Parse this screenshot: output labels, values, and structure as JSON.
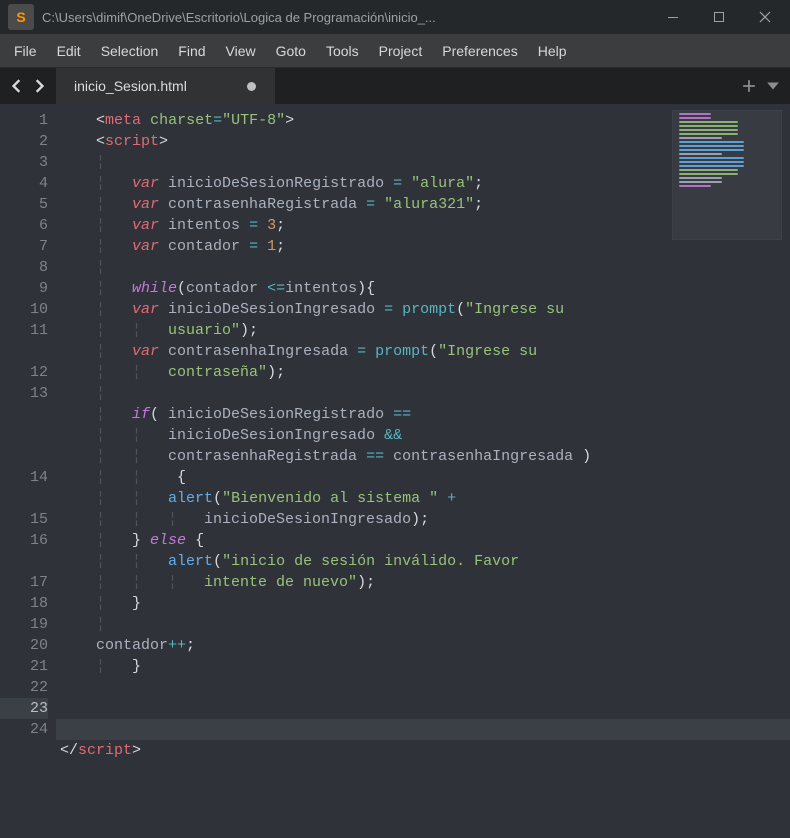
{
  "window": {
    "title": "C:\\Users\\dimif\\OneDrive\\Escritorio\\Logica de Programación\\inicio_...",
    "app_icon_glyph": "S"
  },
  "menu": {
    "items": [
      "File",
      "Edit",
      "Selection",
      "Find",
      "View",
      "Goto",
      "Tools",
      "Project",
      "Preferences",
      "Help"
    ]
  },
  "tab": {
    "label": "inicio_Sesion.html"
  },
  "gutter": {
    "lines": [
      "1",
      "2",
      "3",
      "4",
      "5",
      "6",
      "7",
      "8",
      "9",
      "10",
      "11",
      "12",
      "13",
      "14",
      "15",
      "16",
      "17",
      "18",
      "19",
      "20",
      "21",
      "22",
      "23",
      "24"
    ],
    "current_index": 22
  },
  "code": {
    "l1": {
      "tag": "meta",
      "attr": "charset",
      "eq": "=",
      "val": "\"UTF-8\""
    },
    "l2": {
      "tag": "script"
    },
    "l4": {
      "kw": "var",
      "id": "inicioDeSesionRegistrado",
      "op": "=",
      "val": "\"alura\""
    },
    "l5": {
      "kw": "var",
      "id": "contrasenhaRegistrada",
      "op": "=",
      "val": "\"alura321\""
    },
    "l6": {
      "kw": "var",
      "id": "intentos",
      "op": "=",
      "val": "3"
    },
    "l7": {
      "kw": "var",
      "id": "contador",
      "op": "=",
      "val": "1"
    },
    "l9": {
      "kw": "while",
      "expr_a": "contador",
      "op": "<=",
      "expr_b": "intentos"
    },
    "l10": {
      "kw": "var",
      "id": "inicioDeSesionIngresado",
      "op": "=",
      "fn": "prompt",
      "arg": "\"Ingrese su",
      "arg_wrap": "usuario\""
    },
    "l11": {
      "kw": "var",
      "id": "contrasenhaIngresada",
      "op": "=",
      "fn": "prompt",
      "arg": "\"Ingrese su",
      "arg_wrap": "contraseña\""
    },
    "l13": {
      "kw": "if",
      "a": "inicioDeSesionRegistrado",
      "op1": "==",
      "b": "inicioDeSesionIngresado",
      "and": "&&",
      "c": "contrasenhaRegistrada",
      "op2": "==",
      "d": "contrasenhaIngresada"
    },
    "l14": {
      "fn": "alert",
      "arg": "\"Bienvenido al sistema \"",
      "plus": "+",
      "wrap": "inicioDeSesionIngresado"
    },
    "l15": {
      "close": "}",
      "kw": "else",
      "open": "{"
    },
    "l16": {
      "fn": "alert",
      "arg": "\"inicio de sesión inválido. Favor",
      "wrap": "intente de nuevo\""
    },
    "l17": {
      "close": "}"
    },
    "l19": {
      "id": "contador",
      "op": "++"
    },
    "l20": {
      "close": "}"
    },
    "l24": {
      "tag": "script"
    }
  }
}
